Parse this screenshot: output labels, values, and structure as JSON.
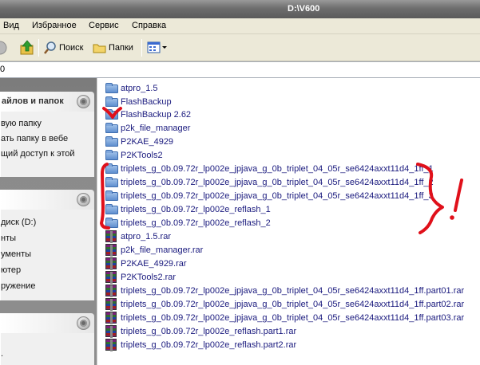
{
  "window": {
    "title": "D:\\V600"
  },
  "menu": [
    "Вид",
    "Избранное",
    "Сервис",
    "Справка"
  ],
  "toolbar": {
    "search_label": "Поиск",
    "folders_label": "Папки"
  },
  "address": {
    "value": "0"
  },
  "taskpane": {
    "panel1_title": "айлов и папок",
    "panel1_tasks": [
      "вую папку",
      "ать папку в вебе",
      "щий доступ к этой"
    ],
    "panel2_tasks": [
      "диск (D:)",
      "нты",
      "ументы",
      "ютер",
      "ружение"
    ]
  },
  "files": [
    {
      "name": "atpro_1.5",
      "type": "folder"
    },
    {
      "name": "FlashBackup",
      "type": "folder"
    },
    {
      "name": "FlashBackup 2.62",
      "type": "folder"
    },
    {
      "name": "p2k_file_manager",
      "type": "folder"
    },
    {
      "name": "P2KAE_4929",
      "type": "folder"
    },
    {
      "name": "P2KTools2",
      "type": "folder"
    },
    {
      "name": "triplets_g_0b.09.72r_lp002e_jpjava_g_0b_triplet_04_05r_se6424axxt11d4_1ff_1",
      "type": "folder"
    },
    {
      "name": "triplets_g_0b.09.72r_lp002e_jpjava_g_0b_triplet_04_05r_se6424axxt11d4_1ff_2",
      "type": "folder"
    },
    {
      "name": "triplets_g_0b.09.72r_lp002e_jpjava_g_0b_triplet_04_05r_se6424axxt11d4_1ff_3",
      "type": "folder"
    },
    {
      "name": "triplets_g_0b.09.72r_lp002e_reflash_1",
      "type": "folder"
    },
    {
      "name": "triplets_g_0b.09.72r_lp002e_reflash_2",
      "type": "folder"
    },
    {
      "name": "atpro_1.5.rar",
      "type": "rar"
    },
    {
      "name": "p2k_file_manager.rar",
      "type": "rar"
    },
    {
      "name": "P2KAE_4929.rar",
      "type": "rar"
    },
    {
      "name": "P2KTools2.rar",
      "type": "rar"
    },
    {
      "name": "triplets_g_0b.09.72r_lp002e_jpjava_g_0b_triplet_04_05r_se6424axxt11d4_1ff.part01.rar",
      "type": "rar"
    },
    {
      "name": "triplets_g_0b.09.72r_lp002e_jpjava_g_0b_triplet_04_05r_se6424axxt11d4_1ff.part02.rar",
      "type": "rar"
    },
    {
      "name": "triplets_g_0b.09.72r_lp002e_jpjava_g_0b_triplet_04_05r_se6424axxt11d4_1ff.part03.rar",
      "type": "rar"
    },
    {
      "name": "triplets_g_0b.09.72r_lp002e_reflash.part1.rar",
      "type": "rar"
    },
    {
      "name": "triplets_g_0b.09.72r_lp002e_reflash.part2.rar",
      "type": "rar"
    }
  ],
  "annotation": {
    "text": "!",
    "color": "#e0101a"
  }
}
